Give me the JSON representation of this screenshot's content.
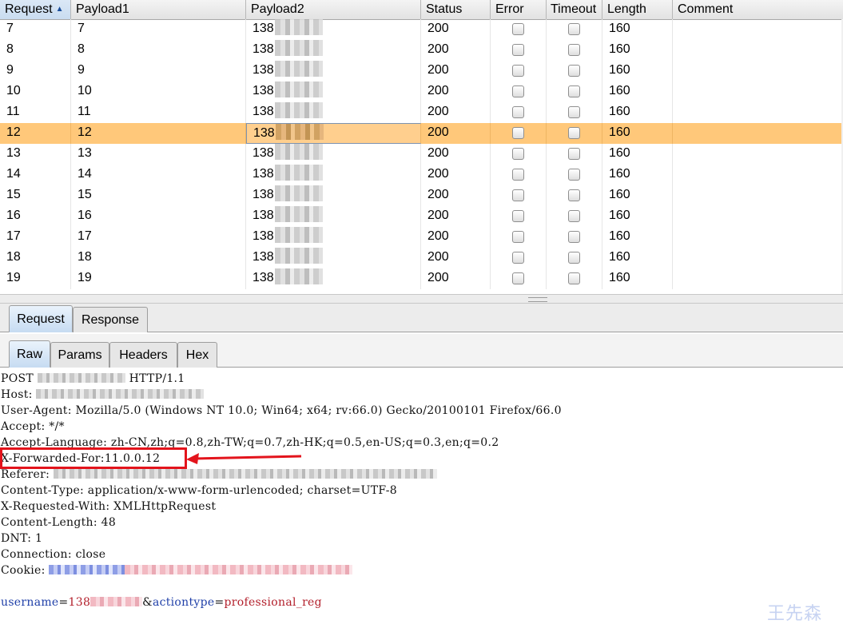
{
  "table": {
    "columns": [
      "Request",
      "Payload1",
      "Payload2",
      "Status",
      "Error",
      "Timeout",
      "Length",
      "Comment"
    ],
    "sorted_column": "Request",
    "sort_direction": "ascending",
    "rows": [
      {
        "request": "7",
        "payload1": "7",
        "payload2": "138",
        "status": "200",
        "length": "160",
        "selected": false
      },
      {
        "request": "8",
        "payload1": "8",
        "payload2": "138",
        "status": "200",
        "length": "160",
        "selected": false
      },
      {
        "request": "9",
        "payload1": "9",
        "payload2": "138",
        "status": "200",
        "length": "160",
        "selected": false
      },
      {
        "request": "10",
        "payload1": "10",
        "payload2": "138",
        "status": "200",
        "length": "160",
        "selected": false
      },
      {
        "request": "11",
        "payload1": "11",
        "payload2": "138",
        "status": "200",
        "length": "160",
        "selected": false
      },
      {
        "request": "12",
        "payload1": "12",
        "payload2": "138",
        "status": "200",
        "length": "160",
        "selected": true
      },
      {
        "request": "13",
        "payload1": "13",
        "payload2": "138",
        "status": "200",
        "length": "160",
        "selected": false
      },
      {
        "request": "14",
        "payload1": "14",
        "payload2": "138",
        "status": "200",
        "length": "160",
        "selected": false
      },
      {
        "request": "15",
        "payload1": "15",
        "payload2": "138",
        "status": "200",
        "length": "160",
        "selected": false
      },
      {
        "request": "16",
        "payload1": "16",
        "payload2": "138",
        "status": "200",
        "length": "160",
        "selected": false
      },
      {
        "request": "17",
        "payload1": "17",
        "payload2": "138",
        "status": "200",
        "length": "160",
        "selected": false
      },
      {
        "request": "18",
        "payload1": "18",
        "payload2": "138",
        "status": "200",
        "length": "160",
        "selected": false
      },
      {
        "request": "19",
        "payload1": "19",
        "payload2": "138",
        "status": "200",
        "length": "160",
        "selected": false
      }
    ]
  },
  "tabs_top": {
    "request": "Request",
    "response": "Response",
    "active": "Request"
  },
  "tabs_sub": {
    "raw": "Raw",
    "params": "Params",
    "headers": "Headers",
    "hex": "Hex",
    "active": "Raw"
  },
  "raw": {
    "post_method": "POST",
    "post_version": "HTTP/1.1",
    "host_label": "Host:",
    "user_agent": "User-Agent: Mozilla/5.0 (Windows NT 10.0; Win64; x64; rv:66.0) Gecko/20100101 Firefox/66.0",
    "accept": "Accept: */*",
    "accept_language": "Accept-Language: zh-CN,zh;q=0.8,zh-TW;q=0.7,zh-HK;q=0.5,en-US;q=0.3,en;q=0.2",
    "x_forwarded_for": "X-Forwarded-For:11.0.0.12",
    "referer_label": "Referer:",
    "content_type": "Content-Type: application/x-www-form-urlencoded; charset=UTF-8",
    "x_requested_with": "X-Requested-With: XMLHttpRequest",
    "content_length": "Content-Length: 48",
    "dnt": "DNT: 1",
    "connection": "Connection: close",
    "cookie_label": "Cookie:",
    "body_username_name": "username",
    "body_eq1": "=",
    "body_username_value": "138",
    "body_amp": "&",
    "body_actiontype_name": "actiontype",
    "body_eq2": "=",
    "body_actiontype_value": "professional_reg"
  },
  "annotation": {
    "box_color": "#e3141c",
    "arrow_color": "#e3141c"
  },
  "watermark": "王先森",
  "colors": {
    "selected_row": "#ffc87a",
    "active_tab": "#c7dcf2",
    "param_name": "#1f3fa8",
    "param_value": "#b3202c"
  }
}
